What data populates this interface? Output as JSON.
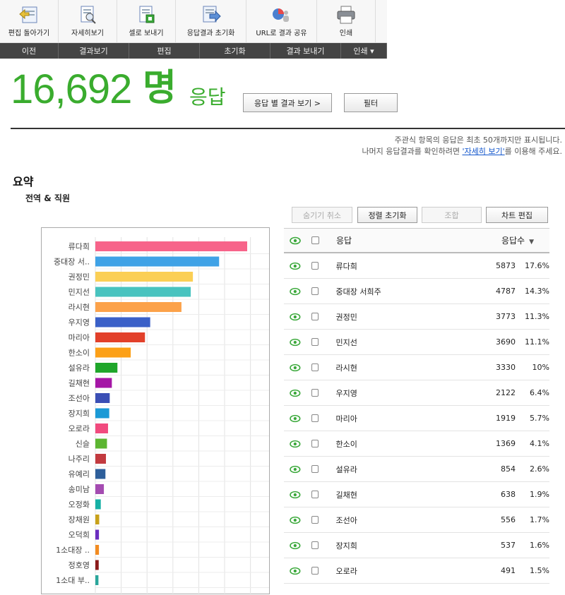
{
  "toolbar": {
    "items": [
      {
        "label": "편집 돌아가기",
        "icon": "back-edit-icon"
      },
      {
        "label": "자세히보기",
        "icon": "detail-view-icon"
      },
      {
        "label": "셀로 보내기",
        "icon": "export-cell-icon"
      },
      {
        "label": "응답결과 초기화",
        "icon": "reset-results-icon"
      },
      {
        "label": "URL로 결과 공유",
        "icon": "share-url-icon"
      },
      {
        "label": "인쇄",
        "icon": "print-icon"
      }
    ],
    "categories": [
      "이전",
      "결과보기",
      "편집",
      "초기화",
      "결과 보내기",
      "인쇄 ▾"
    ]
  },
  "header": {
    "count": "16,692",
    "unit": "명",
    "responses_label": "응답",
    "view_by_response_button": "응답 별 결과 보기 >",
    "filter_button": "필터"
  },
  "notes": {
    "line1": "주관식 항목의 응답은 최초 50개까지만 표시됩니다.",
    "line2_prefix": "나머지 응답결과를 확인하려면 ",
    "line2_link": "'자세히 보기'",
    "line2_suffix": "를 이용해 주세요."
  },
  "summary": {
    "title": "요약",
    "question": "전역 & 직원"
  },
  "controls": {
    "hide_cancel": "숨기기 취소",
    "sort_reset": "정렬 초기화",
    "combine": "조합",
    "chart_edit": "차트 편집"
  },
  "table": {
    "header_response": "응답",
    "header_count": "응답수",
    "rows": [
      {
        "name": "류다희",
        "count": "5873",
        "pct": "17.6%"
      },
      {
        "name": "중대장 서희주",
        "count": "4787",
        "pct": "14.3%"
      },
      {
        "name": "권정민",
        "count": "3773",
        "pct": "11.3%"
      },
      {
        "name": "민지선",
        "count": "3690",
        "pct": "11.1%"
      },
      {
        "name": "라시현",
        "count": "3330",
        "pct": "10%"
      },
      {
        "name": "우지영",
        "count": "2122",
        "pct": "6.4%"
      },
      {
        "name": "마리아",
        "count": "1919",
        "pct": "5.7%"
      },
      {
        "name": "한소이",
        "count": "1369",
        "pct": "4.1%"
      },
      {
        "name": "설유라",
        "count": "854",
        "pct": "2.6%"
      },
      {
        "name": "길채현",
        "count": "638",
        "pct": "1.9%"
      },
      {
        "name": "조선아",
        "count": "556",
        "pct": "1.7%"
      },
      {
        "name": "장지희",
        "count": "537",
        "pct": "1.6%"
      },
      {
        "name": "오로라",
        "count": "491",
        "pct": "1.5%"
      }
    ]
  },
  "chart_data": {
    "type": "bar",
    "orientation": "horizontal",
    "categories": [
      "류다희",
      "중대장 서..",
      "권정민",
      "민지선",
      "라시현",
      "우지영",
      "마리아",
      "한소이",
      "설유라",
      "길채현",
      "조선아",
      "장지희",
      "오로라",
      "신슬",
      "나주리",
      "유예리",
      "송미남",
      "오정화",
      "장채원",
      "오덕희",
      "1소대장 ..",
      "정호영",
      "1소대 부.."
    ],
    "values": [
      5873,
      4787,
      3773,
      3690,
      3330,
      2122,
      1919,
      1369,
      854,
      638,
      556,
      537,
      491,
      450,
      410,
      390,
      330,
      210,
      150,
      140,
      140,
      130,
      120
    ],
    "colors": [
      "#f7648a",
      "#3fa2e6",
      "#fbcf55",
      "#48c3bf",
      "#fca24a",
      "#3a60c8",
      "#e2402a",
      "#fca017",
      "#1fa62a",
      "#a516a6",
      "#3b4fb5",
      "#1b9ad6",
      "#f14a7e",
      "#5cb531",
      "#c23a3f",
      "#2e5f9b",
      "#a44bb1",
      "#16b0a5",
      "#c8a11a",
      "#6b2dbf",
      "#f28b21",
      "#8b1a1a",
      "#2aa69b"
    ],
    "grid": true,
    "xlim": [
      0,
      6000
    ]
  }
}
